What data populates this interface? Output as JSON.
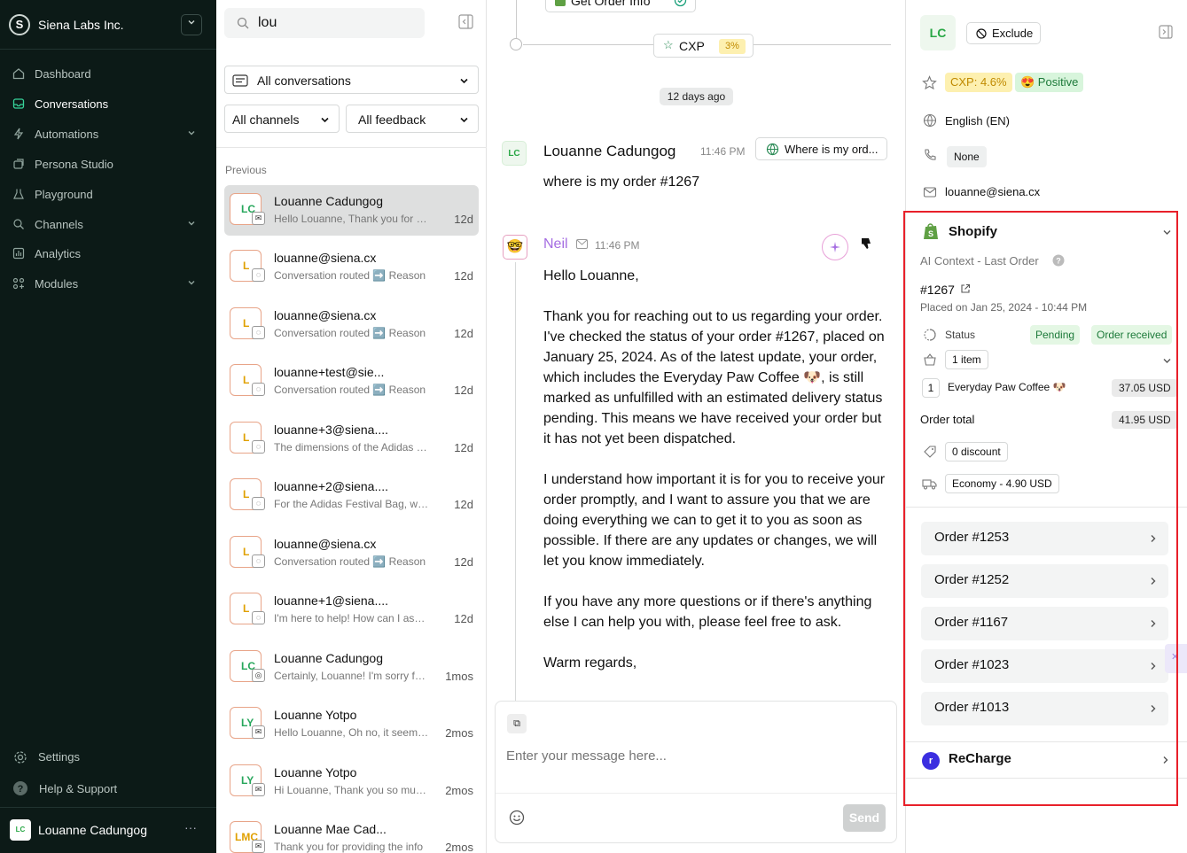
{
  "sidebar": {
    "org_initial": "S",
    "org_name": "Siena Labs Inc.",
    "nav": [
      {
        "label": "Dashboard",
        "icon": "home-icon"
      },
      {
        "label": "Conversations",
        "icon": "inbox-icon"
      },
      {
        "label": "Automations",
        "icon": "bolt-icon"
      },
      {
        "label": "Persona Studio",
        "icon": "persona-icon"
      },
      {
        "label": "Playground",
        "icon": "flask-icon"
      },
      {
        "label": "Channels",
        "icon": "channels-icon"
      },
      {
        "label": "Analytics",
        "icon": "analytics-icon"
      },
      {
        "label": "Modules",
        "icon": "modules-icon"
      }
    ],
    "settings": "Settings",
    "help": "Help & Support",
    "user_initials": "LC",
    "user_name": "Louanne Cadungog"
  },
  "list": {
    "search_value": "lou",
    "filter_conversations": "All conversations",
    "filter_channels": "All channels",
    "filter_feedback": "All feedback",
    "section": "Previous",
    "items": [
      {
        "initials": "LC",
        "name": "Louanne Cadungog",
        "preview": "Hello Louanne, Thank you for reaching out",
        "age": "12d",
        "channel": "email"
      },
      {
        "initials": "L",
        "name": "louanne@siena.cx",
        "preview": "Conversation routed ➡️ Reason",
        "age": "12d",
        "channel": "chat"
      },
      {
        "initials": "L",
        "name": "louanne@siena.cx",
        "preview": "Conversation routed ➡️ Reason",
        "age": "12d",
        "channel": "chat"
      },
      {
        "initials": "L",
        "name": "louanne+test@sie...",
        "preview": "Conversation routed ➡️ Reason",
        "age": "12d",
        "channel": "chat"
      },
      {
        "initials": "L",
        "name": "louanne+3@siena....",
        "preview": "The dimensions of the Adidas Festival",
        "age": "12d",
        "channel": "chat"
      },
      {
        "initials": "L",
        "name": "louanne+2@siena....",
        "preview": "For the Adidas Festival Bag, we have",
        "age": "12d",
        "channel": "chat"
      },
      {
        "initials": "L",
        "name": "louanne@siena.cx",
        "preview": "Conversation routed ➡️ Reason",
        "age": "12d",
        "channel": "chat"
      },
      {
        "initials": "L",
        "name": "louanne+1@siena....",
        "preview": "I'm here to help! How can I assist you",
        "age": "12d",
        "channel": "chat"
      },
      {
        "initials": "LC",
        "name": "Louanne Cadungog",
        "preview": "Certainly, Louanne! I'm sorry for the",
        "age": "1mos",
        "channel": "whatsapp"
      },
      {
        "initials": "LY",
        "name": "Louanne Yotpo",
        "preview": "Hello Louanne, Oh no, it seems that",
        "age": "2mos",
        "channel": "email"
      },
      {
        "initials": "LY",
        "name": "Louanne Yotpo",
        "preview": "Hi Louanne, Thank you so much for",
        "age": "2mos",
        "channel": "email"
      },
      {
        "initials": "LMC",
        "name": "Louanne Mae Cad...",
        "preview": "Thank you for providing the info",
        "age": "2mos",
        "channel": "email"
      }
    ]
  },
  "chat": {
    "top_chip": "Get Order Info",
    "cxp_chip": "CXP",
    "cxp_value": "3%",
    "date_pill": "12 days ago",
    "customer": {
      "initials": "LC",
      "name": "Louanne Cadungog",
      "time": "11:46 PM",
      "intent": "Where is my ord...",
      "text": "where is my order #1267"
    },
    "agent": {
      "name": "Neil",
      "time": "11:46 PM",
      "text": "Hello Louanne,\n\nThank you for reaching out to us regarding your order. I've checked the status of your order #1267, placed on January 25, 2024. As of the latest update, your order, which includes the Everyday Paw Coffee 🐶, is still marked as unfulfilled with an estimated delivery status pending. This means we have received your order but it has not yet been dispatched.\n\nI understand how important it is for you to receive your order promptly, and I want to assure you that we are doing everything we can to get it to you as soon as possible. If there are any updates or changes, we will let you know immediately.\n\nIf you have any more questions or if there's anything else I can help you with, please feel free to ask.\n\nWarm regards,"
    },
    "composer_placeholder": "Enter your message here...",
    "send_label": "Send"
  },
  "profile": {
    "initials": "LC",
    "exclude_label": "Exclude",
    "cxp_label": "CXP: 4.6%",
    "sentiment": "😍 Positive",
    "language": "English (EN)",
    "phone": "None",
    "email": "louanne@siena.cx",
    "shopify": {
      "title": "Shopify",
      "context": "AI Context - Last Order",
      "order_number": "#1267",
      "placed_on": "Placed on Jan 25, 2024 - 10:44 PM",
      "status_label": "Status",
      "status_pending": "Pending",
      "status_received": "Order received",
      "items_count": "1 item",
      "line_qty": "1",
      "line_name": "Everyday Paw Coffee 🐶",
      "line_price": "37.05 USD",
      "total_label": "Order total",
      "total_value": "41.95 USD",
      "discount": "0 discount",
      "shipping": "Economy - 4.90 USD"
    },
    "orders": [
      "Order #1253",
      "Order #1252",
      "Order #1167",
      "Order #1023",
      "Order #1013"
    ],
    "recharge": "ReCharge"
  },
  "colors": {
    "sidebar_bg": "#0c1a17",
    "accent_green": "#28a745",
    "highlight_red": "#e8202a",
    "cxp_yellow": "#fdf0b0",
    "positive_green": "#d8f5dc"
  }
}
